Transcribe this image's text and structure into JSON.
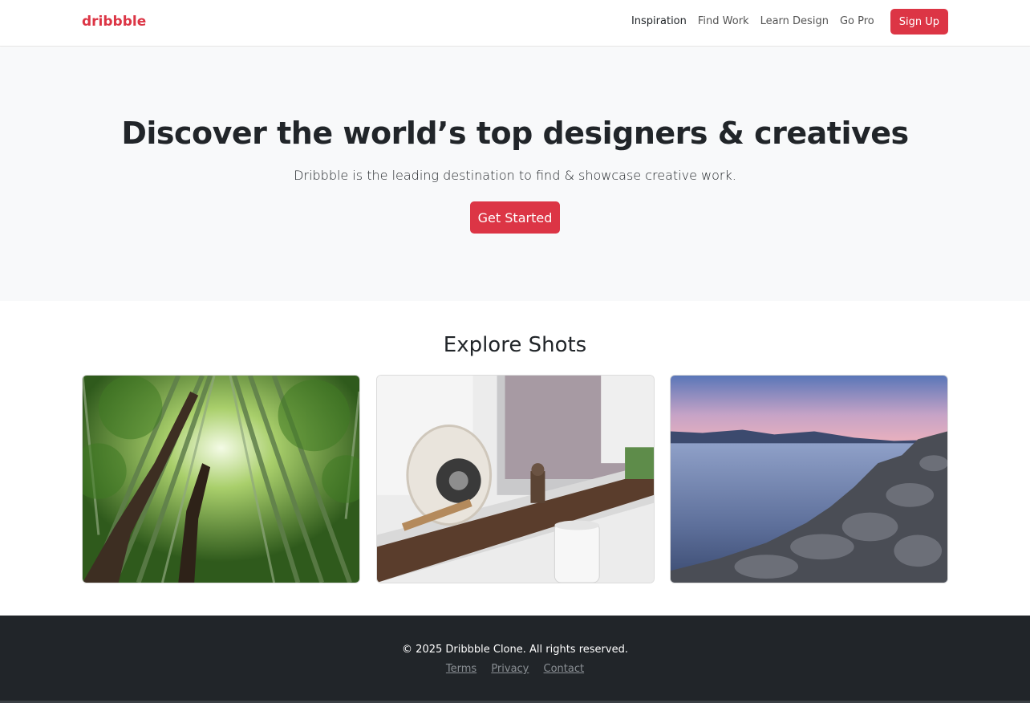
{
  "nav": {
    "brand": "dribbble",
    "links": [
      "Inspiration",
      "Find Work",
      "Learn Design",
      "Go Pro"
    ],
    "signup_label": "Sign Up"
  },
  "hero": {
    "title": "Discover the world’s top designers & creatives",
    "subtitle": "Dribbble is the leading destination to find & showcase creative work.",
    "cta_label": "Get Started"
  },
  "shots": {
    "title": "Explore Shots"
  },
  "footer": {
    "copyright": "© 2025 Dribbble Clone. All rights reserved.",
    "links": [
      "Terms",
      "Privacy",
      "Contact"
    ]
  },
  "colors": {
    "accent": "#dc3545",
    "hero_bg": "#f8f9fa",
    "footer_bg": "#212529"
  }
}
